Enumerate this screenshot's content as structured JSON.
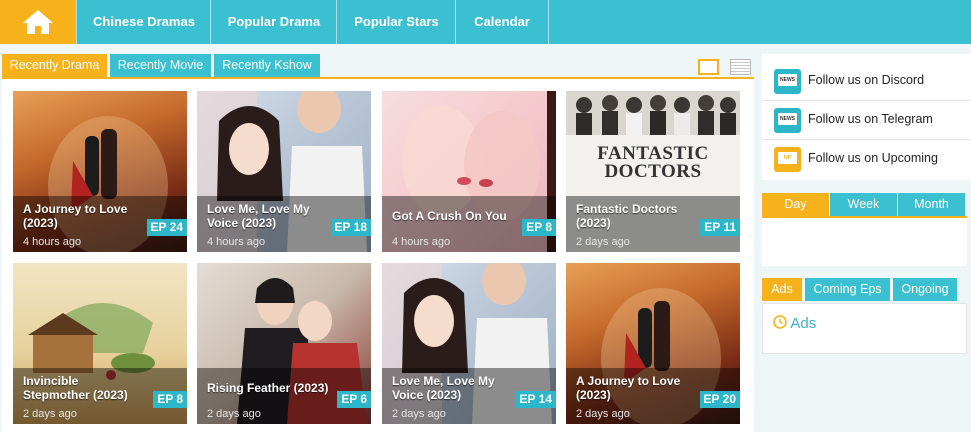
{
  "nav": {
    "home_icon": "home-icon",
    "items": [
      "Chinese Dramas",
      "Popular Drama",
      "Popular Stars",
      "Calendar"
    ]
  },
  "tabs": [
    "Recently Drama",
    "Recently Movie",
    "Recently Kshow"
  ],
  "view_icons": [
    "grid-view-icon",
    "list-view-icon"
  ],
  "cards": [
    {
      "title": "A Journey to Love (2023)",
      "time": "4 hours ago",
      "ep": "EP 24"
    },
    {
      "title": "Love Me, Love My Voice (2023)",
      "time": "4 hours ago",
      "ep": "EP 18"
    },
    {
      "title": "Got A Crush On You",
      "time": "4 hours ago",
      "ep": "EP 8"
    },
    {
      "title": "Fantastic Doctors (2023)",
      "time": "2 days ago",
      "ep": "EP 11",
      "poster_text": "FANTASTIC DOCTORS"
    },
    {
      "title": "Invincible Stepmother (2023)",
      "time": "2 days ago",
      "ep": "EP 8"
    },
    {
      "title": "Rising Feather (2023)",
      "time": "2 days ago",
      "ep": "EP 6"
    },
    {
      "title": "Love Me, Love My Voice (2023)",
      "time": "2 days ago",
      "ep": "EP 14"
    },
    {
      "title": "A Journey to Love (2023)",
      "time": "2 days ago",
      "ep": "EP 20"
    }
  ],
  "sidebar": {
    "follow": [
      {
        "label": "Follow us on Discord",
        "icon": "discord-news-icon",
        "icon_text": "NEWS"
      },
      {
        "label": "Follow us on Telegram",
        "icon": "telegram-news-icon",
        "icon_text": "NEWS"
      },
      {
        "label": "Follow us on Upcoming",
        "icon": "upcoming-tv-icon",
        "icon_text": "UP"
      }
    ],
    "period_tabs": [
      "Day",
      "Week",
      "Month"
    ],
    "small_tabs": [
      "Ads",
      "Coming Eps",
      "Ongoing"
    ],
    "ads_link": "Ads"
  },
  "colors": {
    "accent": "#3bc0d2",
    "highlight": "#f7b21b",
    "badge": "#2cb6c9"
  }
}
